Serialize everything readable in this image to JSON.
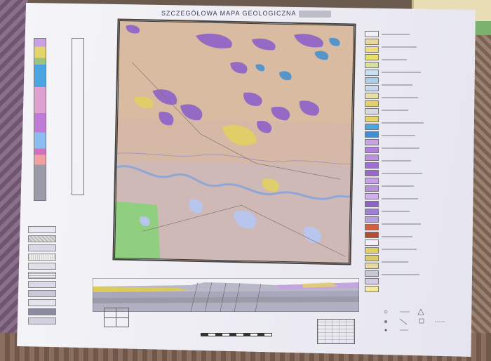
{
  "map_sheet": {
    "title": "SZCZEGÓŁOWA MAPA GEOLOGICZNA POLSKI",
    "colors": {
      "paper": "#f2f1f6",
      "map_base": "#d7b9a4",
      "river": "#8fa6d6",
      "pleistocene_violet": "#8e62c8",
      "blue_units": "#3f8fd2",
      "yellow_units": "#e3d35a",
      "green_area": "#8fcf7f",
      "section_yellow": "#dccb5a",
      "section_grey": "#9a9aa8"
    },
    "icons": [
      "compass-rose-icon",
      "scale-bar-icon"
    ]
  }
}
